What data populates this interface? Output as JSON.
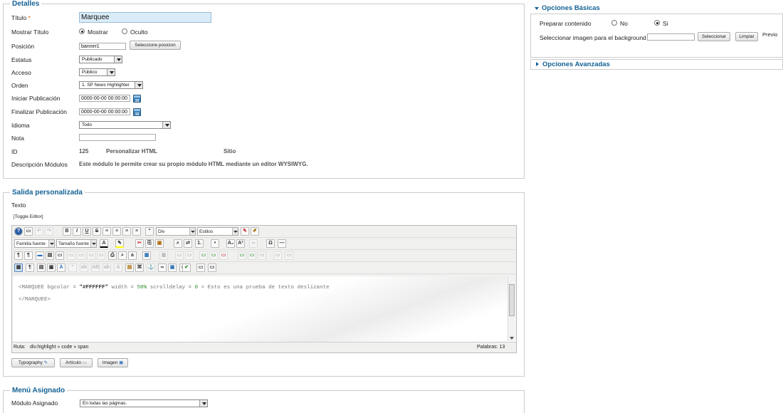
{
  "detalles": {
    "legend": "Detalles",
    "titulo_label": "Título",
    "required_mark": "*",
    "titulo_value": "Marquee",
    "mostrar_titulo_label": "Mostrar Título",
    "mostrar_option": "Mostrar",
    "oculto_option": "Oculto",
    "posicion_label": "Posición",
    "posicion_value": "banner1",
    "seleccione_posicion_button": "Seleccione posicion",
    "estatus_label": "Estatus",
    "estatus_value": "Publicado",
    "acceso_label": "Acceso",
    "acceso_value": "Público",
    "orden_label": "Orden",
    "orden_value": "1. SP News Highlighter",
    "iniciar_label": "Iniciar Publicación",
    "iniciar_value": "0000-00-00 00:00:00",
    "finalizar_label": "Finalizar Publicación",
    "finalizar_value": "0000-00-00 00:00:00",
    "idioma_label": "Idioma",
    "idioma_value": "Todo",
    "nota_label": "Nota",
    "nota_value": "",
    "id_label": "ID",
    "id_value": "125",
    "module_type": "Personalizar HTML",
    "module_site": "Sitio",
    "descripcion_label": "Descripción Módulos",
    "descripcion_value": "Este módulo le permite crear su propio módulo HTML mediante un editor WYSIWYG."
  },
  "salida": {
    "legend": "Salida personalizada",
    "texto_label": "Texto",
    "toggle_editor": "[Toggle Editor]",
    "format_select": "Div",
    "styles_select": "Estilos",
    "font_family_select": "Familia fuente",
    "font_size_select": "Tamaño fuente",
    "code_line1_tag": "<MARQUEE",
    "code_line1_attr1": " bgcolor = ",
    "code_line1_val1": "\"#FFFFFF\"",
    "code_line1_attr2": " width = ",
    "code_line1_val2": "50%",
    "code_line1_attr3": " scrolldelay = ",
    "code_line1_val3": "0",
    "code_line1_end": " > Esto es una prueba de texto deslizante",
    "code_line2": "</MARQUEE>",
    "path_label": "Ruta:",
    "path_value": "div.highlight » code » span",
    "word_count": "Palabras: 13",
    "typography_button": "Typography",
    "articulo_button": "Artículo",
    "imagen_button": "Imagen"
  },
  "menu": {
    "legend": "Menú Asignado",
    "modulo_label": "Módulo Asignado",
    "modulo_value": "En todas las páginas."
  },
  "opciones_basicas": {
    "title": "Opciones Básicas",
    "preparar_label": "Preparar contenido",
    "no_option": "No",
    "si_option": "Si",
    "imagen_label": "Seleccionar imagen para el background",
    "imagen_value": "",
    "seleccionar_button": "Seleccionar",
    "limpiar_button": "Limpiar",
    "previo_label": "Previo"
  },
  "opciones_avanzadas": {
    "title": "Opciones Avanzadas"
  },
  "colors": {
    "legend": "#146295",
    "title_field_bg": "#d9ecf8",
    "code_string": "#333333",
    "code_number": "#2a8a2a"
  }
}
